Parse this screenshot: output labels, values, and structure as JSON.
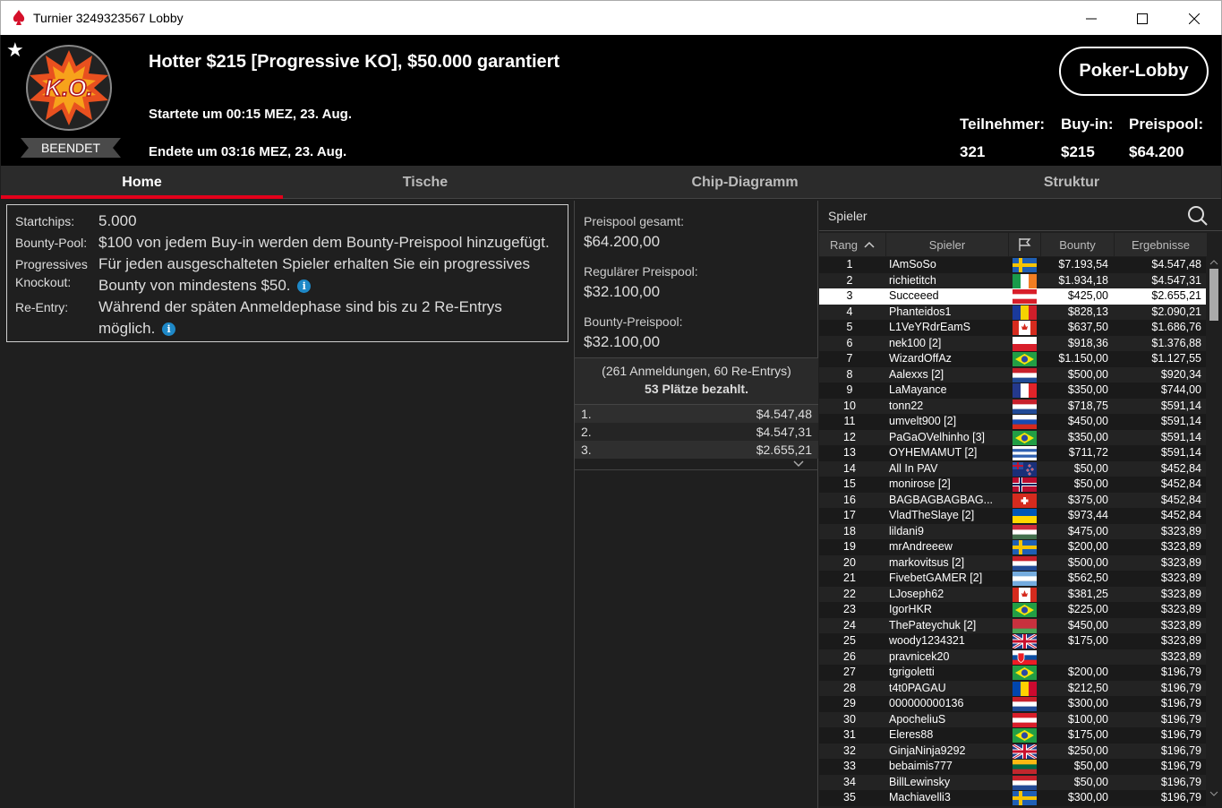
{
  "window": {
    "title": "Turnier 3249323567 Lobby",
    "controls": [
      "minimize",
      "maximize",
      "close"
    ]
  },
  "header": {
    "badge": "BEENDET",
    "logo_text": "K.O.",
    "name": "Hotter $215 [Progressive KO], $50.000 garantiert",
    "started": "Startete um 00:15 MEZ, 23. Aug.",
    "ended": "Endete um 03:16 MEZ, 23. Aug.",
    "lobby_button": "Poker-Lobby",
    "stats": {
      "players_label": "Teilnehmer:",
      "players": "321",
      "buyin_label": "Buy-in:",
      "buyin": "$215",
      "pool_label": "Preispool:",
      "pool": "$64.200"
    }
  },
  "tabs": [
    {
      "label": "Home",
      "active": true
    },
    {
      "label": "Tische"
    },
    {
      "label": "Chip-Diagramm"
    },
    {
      "label": "Struktur"
    }
  ],
  "info": {
    "startchips_label": "Startchips:",
    "startchips": "5.000",
    "bounty_label": "Bounty-Pool:",
    "bounty": "$100 von jedem Buy-in werden dem Bounty-Preispool hinzugefügt.",
    "pko_label1": "Progressives",
    "pko_label2": "Knockout:",
    "pko_text1": "Für jeden ausgeschalteten Spieler erhalten Sie ein progressives",
    "pko_text2": "Bounty von mindestens $50.",
    "reentry_label": "Re-Entry:",
    "reentry_text1": "Während der späten Anmeldephase sind bis zu 2 Re-Entrys",
    "reentry_text2": "möglich."
  },
  "prizepool": {
    "total_label": "Preispool gesamt:",
    "total": "$64.200,00",
    "regular_label": "Regulärer Preispool:",
    "regular": "$32.100,00",
    "bounty_label": "Bounty-Preispool:",
    "bounty": "$32.100,00",
    "registrations": "(261 Anmeldungen, 60 Re-Entrys)",
    "paid": "53 Plätze bezahlt.",
    "payouts": [
      {
        "place": "1.",
        "amount": "$4.547,48"
      },
      {
        "place": "2.",
        "amount": "$4.547,31"
      },
      {
        "place": "3.",
        "amount": "$2.655,21"
      }
    ]
  },
  "players_panel": {
    "search_label": "Spieler",
    "columns": [
      "Rang",
      "Spieler",
      "",
      "Bounty",
      "Ergebnisse"
    ],
    "highlight_rank": "3",
    "rows": [
      {
        "rank": "1",
        "name": "IAmSoSo",
        "flag": "se",
        "bounty": "$7.193,54",
        "result": "$4.547,48"
      },
      {
        "rank": "2",
        "name": "richietitch",
        "flag": "ie",
        "bounty": "$1.934,18",
        "result": "$4.547,31"
      },
      {
        "rank": "3",
        "name": "Succeeed",
        "flag": "at",
        "bounty": "$425,00",
        "result": "$2.655,21"
      },
      {
        "rank": "4",
        "name": "Phanteidos1",
        "flag": "ro",
        "bounty": "$828,13",
        "result": "$2.090,21"
      },
      {
        "rank": "5",
        "name": "L1VeYRdrEamS",
        "flag": "ca",
        "bounty": "$637,50",
        "result": "$1.686,76"
      },
      {
        "rank": "6",
        "name": "nek100 [2]",
        "flag": "pl",
        "bounty": "$918,36",
        "result": "$1.376,88"
      },
      {
        "rank": "7",
        "name": "WizardOffAz",
        "flag": "br",
        "bounty": "$1.150,00",
        "result": "$1.127,55"
      },
      {
        "rank": "8",
        "name": "Aalexxs [2]",
        "flag": "nl",
        "bounty": "$500,00",
        "result": "$920,34"
      },
      {
        "rank": "9",
        "name": "LaMayance",
        "flag": "fr",
        "bounty": "$350,00",
        "result": "$744,00"
      },
      {
        "rank": "10",
        "name": "tonn22",
        "flag": "nl",
        "bounty": "$718,75",
        "result": "$591,14"
      },
      {
        "rank": "11",
        "name": "umvelt900 [2]",
        "flag": "ru",
        "bounty": "$450,00",
        "result": "$591,14"
      },
      {
        "rank": "12",
        "name": "PaGaOVelhinho [3]",
        "flag": "br",
        "bounty": "$350,00",
        "result": "$591,14"
      },
      {
        "rank": "13",
        "name": "OYHEMAMUT [2]",
        "flag": "uy",
        "bounty": "$711,72",
        "result": "$591,14"
      },
      {
        "rank": "14",
        "name": "All In PAV",
        "flag": "nz",
        "bounty": "$50,00",
        "result": "$452,84"
      },
      {
        "rank": "15",
        "name": "monirose [2]",
        "flag": "no",
        "bounty": "$50,00",
        "result": "$452,84"
      },
      {
        "rank": "16",
        "name": "BAGBAGBAGBAG...",
        "flag": "ch",
        "bounty": "$375,00",
        "result": "$452,84"
      },
      {
        "rank": "17",
        "name": "VladTheSlaye [2]",
        "flag": "ua",
        "bounty": "$973,44",
        "result": "$452,84"
      },
      {
        "rank": "18",
        "name": "lildani9",
        "flag": "hu",
        "bounty": "$475,00",
        "result": "$323,89"
      },
      {
        "rank": "19",
        "name": "mrAndreeew",
        "flag": "se",
        "bounty": "$200,00",
        "result": "$323,89"
      },
      {
        "rank": "20",
        "name": "markovitsus [2]",
        "flag": "nl",
        "bounty": "$500,00",
        "result": "$323,89"
      },
      {
        "rank": "21",
        "name": "FivebetGAMER [2]",
        "flag": "ar",
        "bounty": "$562,50",
        "result": "$323,89"
      },
      {
        "rank": "22",
        "name": "LJoseph62",
        "flag": "ca",
        "bounty": "$381,25",
        "result": "$323,89"
      },
      {
        "rank": "23",
        "name": "IgorHKR",
        "flag": "br",
        "bounty": "$225,00",
        "result": "$323,89"
      },
      {
        "rank": "24",
        "name": "ThePateychuk [2]",
        "flag": "by",
        "bounty": "$450,00",
        "result": "$323,89"
      },
      {
        "rank": "25",
        "name": "woody1234321",
        "flag": "gb",
        "bounty": "$175,00",
        "result": "$323,89"
      },
      {
        "rank": "26",
        "name": "pravnicek20",
        "flag": "sk",
        "bounty": "",
        "result": "$323,89"
      },
      {
        "rank": "27",
        "name": "tgrigoletti",
        "flag": "br",
        "bounty": "$200,00",
        "result": "$196,79"
      },
      {
        "rank": "28",
        "name": "t4t0PAGAU",
        "flag": "md",
        "bounty": "$212,50",
        "result": "$196,79"
      },
      {
        "rank": "29",
        "name": "000000000136",
        "flag": "nl",
        "bounty": "$300,00",
        "result": "$196,79"
      },
      {
        "rank": "30",
        "name": "ApocheliuS",
        "flag": "at",
        "bounty": "$100,00",
        "result": "$196,79"
      },
      {
        "rank": "31",
        "name": "Eleres88",
        "flag": "br",
        "bounty": "$175,00",
        "result": "$196,79"
      },
      {
        "rank": "32",
        "name": "GinjaNinja9292",
        "flag": "gb",
        "bounty": "$250,00",
        "result": "$196,79"
      },
      {
        "rank": "33",
        "name": "bebaimis777",
        "flag": "lt",
        "bounty": "$50,00",
        "result": "$196,79"
      },
      {
        "rank": "34",
        "name": "BillLewinsky",
        "flag": "nl",
        "bounty": "$50,00",
        "result": "$196,79"
      },
      {
        "rank": "35",
        "name": "Machiavelli3",
        "flag": "se",
        "bounty": "$300,00",
        "result": "$196,79"
      }
    ]
  }
}
